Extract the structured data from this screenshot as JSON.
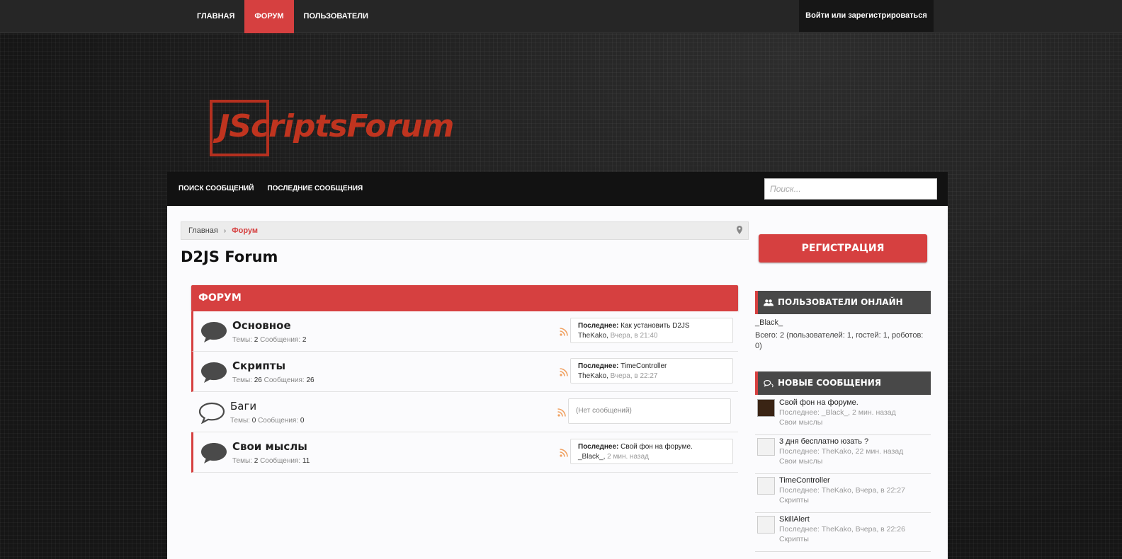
{
  "topnav": {
    "items": [
      "ГЛАВНАЯ",
      "ФОРУМ",
      "ПОЛЬЗОВАТЕЛИ"
    ],
    "login": "Войти или зарегистрироваться"
  },
  "logo": {
    "text": "JScriptsForum"
  },
  "subnav": {
    "links": [
      "ПОИСК СООБЩЕНИЙ",
      "ПОСЛЕДНИЕ СООБЩЕНИЯ"
    ],
    "search_placeholder": "Поиск..."
  },
  "breadcrumb": {
    "home": "Главная",
    "current": "Форум"
  },
  "page_title": "D2JS Forum",
  "forum": {
    "header": "ФОРУМ",
    "stats_threads_label": "Темы:",
    "stats_posts_label": "Сообщения:",
    "last_label": "Последнее:",
    "rows": [
      {
        "name": "Основное",
        "threads": "2",
        "posts": "2",
        "last_title": "Как установить D2JS",
        "last_user": "TheKako,",
        "last_time": "Вчера, в 21:40"
      },
      {
        "name": "Скрипты",
        "threads": "26",
        "posts": "26",
        "last_title": "TimeController",
        "last_user": "TheKako,",
        "last_time": "Вчера, в 22:27"
      },
      {
        "name": "Баги",
        "threads": "0",
        "posts": "0",
        "empty_text": "(Нет сообщений)"
      },
      {
        "name": "Свои мыслы",
        "threads": "2",
        "posts": "11",
        "last_title": "Свой фон на форуме.",
        "last_user": "_Black_,",
        "last_time": "2 мин. назад"
      }
    ]
  },
  "sidebar": {
    "register": "РЕГИСТРАЦИЯ",
    "online": {
      "title": "ПОЛЬЗОВАТЕЛИ ОНЛАЙН",
      "user": "_Black_",
      "total": "Всего: 2 (пользователей: 1, гостей: 1, роботов: 0)"
    },
    "new_posts": {
      "title": "НОВЫЕ СООБЩЕНИЯ",
      "items": [
        {
          "title": "Свой фон на форуме.",
          "meta": "Последнее: _Black_, 2 мин. назад",
          "forum": "Свои мыслы"
        },
        {
          "title": "3 дня бесплатно юзать ?",
          "meta": "Последнее: TheKako, 22 мин. назад",
          "forum": "Свои мыслы"
        },
        {
          "title": "TimeController",
          "meta": "Последнее: TheKako, Вчера, в 22:27",
          "forum": "Скрипты"
        },
        {
          "title": "SkillAlert",
          "meta": "Последнее: TheKako, Вчера, в 22:26",
          "forum": "Скрипты"
        }
      ]
    }
  },
  "colors": {
    "accent": "#d64040",
    "topbar": "#262626",
    "logo": "#c0341f"
  }
}
